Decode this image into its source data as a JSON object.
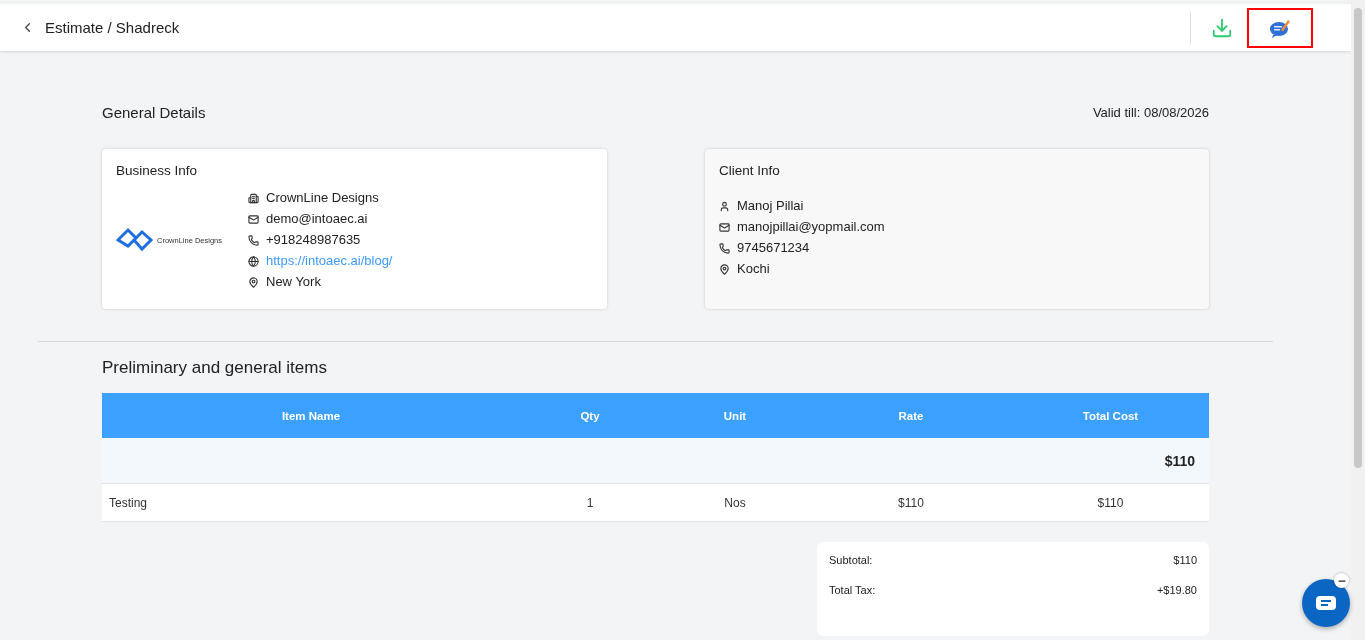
{
  "header": {
    "breadcrumb": "Estimate / Shadreck"
  },
  "general": {
    "title": "General Details",
    "valid_till": "Valid till: 08/08/2026"
  },
  "business": {
    "title": "Business Info",
    "logo_text": "CrownLine Designs",
    "rows": [
      {
        "kind": "company",
        "text": "CrownLine Designs"
      },
      {
        "kind": "email",
        "text": "demo@intoaec.ai"
      },
      {
        "kind": "phone",
        "text": "+918248987635"
      },
      {
        "kind": "website",
        "text": "https://intoaec.ai/blog/"
      },
      {
        "kind": "location",
        "text": "New York"
      }
    ]
  },
  "client": {
    "title": "Client Info",
    "rows": [
      {
        "kind": "person",
        "text": "Manoj Pillai"
      },
      {
        "kind": "email",
        "text": "manojpillai@yopmail.com"
      },
      {
        "kind": "phone",
        "text": "9745671234"
      },
      {
        "kind": "location",
        "text": "Kochi"
      }
    ]
  },
  "section": {
    "title": "Preliminary and general items"
  },
  "table": {
    "columns": [
      "Item Name",
      "Qty",
      "Unit",
      "Rate",
      "Total Cost"
    ],
    "group_total": "$110",
    "rows": [
      [
        "Testing",
        "1",
        "Nos",
        "$110",
        "$110"
      ]
    ]
  },
  "totals": [
    {
      "label": "Subtotal:",
      "value": "$110"
    },
    {
      "label": "Total Tax:",
      "value": "+$19.80"
    }
  ]
}
